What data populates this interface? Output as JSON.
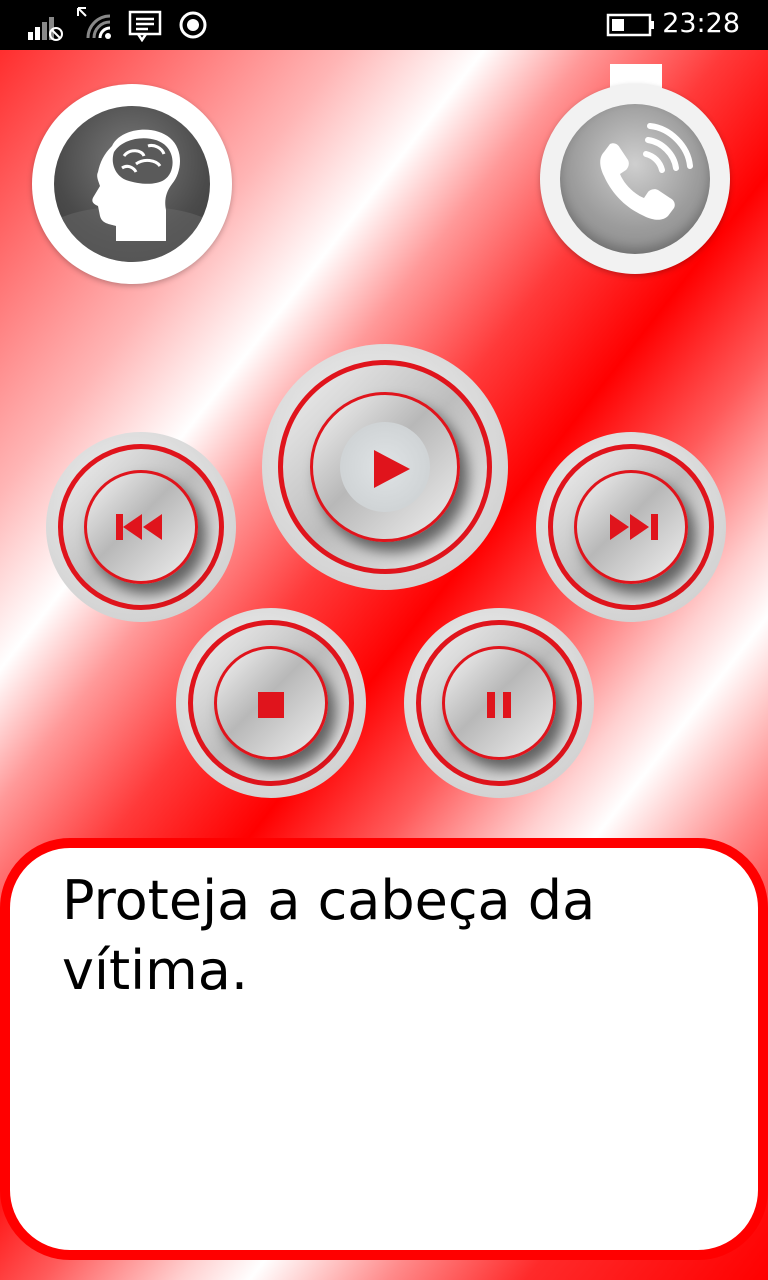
{
  "status_bar": {
    "time": "23:28",
    "icons": [
      "signal-icon",
      "wifi-icon",
      "message-icon",
      "location-icon",
      "battery-icon"
    ]
  },
  "header": {
    "head_button_icon": "head-brain-icon",
    "call_button_icon": "phone-call-icon"
  },
  "player": {
    "buttons": [
      "rewind",
      "play",
      "fast-forward",
      "stop",
      "pause"
    ]
  },
  "instruction": {
    "text": "Proteja a cabeça da vítima."
  },
  "colors": {
    "accent": "#ff0000",
    "button_ring": "#e0141c"
  }
}
